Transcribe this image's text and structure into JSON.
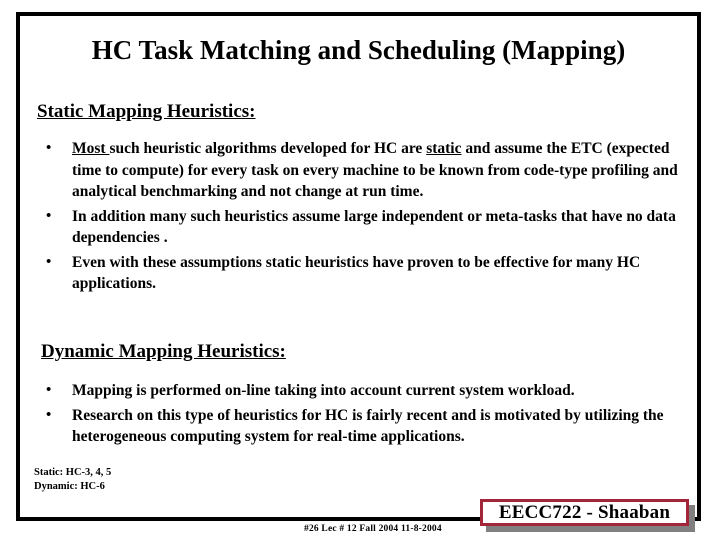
{
  "slide": {
    "title": "HC Task  Matching and Scheduling (Mapping)",
    "sections": [
      {
        "heading": "Static Mapping Heuristics:",
        "bullets": [
          {
            "marker": "•",
            "segments": [
              {
                "text": "Most ",
                "underline": true
              },
              {
                "text": "such heuristic algorithms developed for  HC are ",
                "underline": false
              },
              {
                "text": "static",
                "underline": true
              },
              {
                "text": " and assume the ETC (expected time to compute) for  every task on every machine to be known from code-type profiling and  analytical benchmarking and not change at run time.",
                "underline": false
              }
            ]
          },
          {
            "marker": "•",
            "segments": [
              {
                "text": "In addition many such heuristics assume large independent or  meta-tasks that have no data dependencies .",
                "underline": false
              }
            ]
          },
          {
            "marker": "•",
            "segments": [
              {
                "text": "Even with these  assumptions static heuristics have proven to be effective for many HC applications.",
                "underline": false
              }
            ]
          }
        ]
      },
      {
        "heading": "Dynamic Mapping Heuristics:",
        "bullets": [
          {
            "marker": "•",
            "segments": [
              {
                "text": "Mapping is performed on-line taking into account current system workload.",
                "underline": false
              }
            ]
          },
          {
            "marker": "•",
            "segments": [
              {
                "text": "Research on this type of  heuristics for HC is fairly recent and is motivated by utilizing the heterogeneous computing system for real-time applications.",
                "underline": false
              }
            ]
          }
        ]
      }
    ],
    "notes": "Static:  HC-3, 4, 5\nDynamic:  HC-6",
    "footer": "#26   Lec # 12   Fall 2004  11-8-2004",
    "credit": "EECC722 - Shaaban",
    "colors": {
      "credit_border": "#a32638",
      "credit_shadow": "#808080",
      "frame": "#000000",
      "text": "#000000",
      "background": "#ffffff"
    }
  }
}
